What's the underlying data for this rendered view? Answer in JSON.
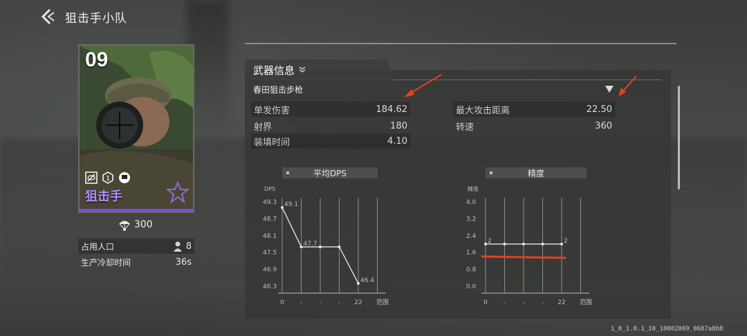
{
  "header": {
    "title": "狙击手小队"
  },
  "unit": {
    "number": "09",
    "role": "狙击手",
    "cost": "300",
    "stats": [
      {
        "label": "占用人口",
        "value": "8"
      },
      {
        "label": "生产冷却时间",
        "value": "36s"
      }
    ]
  },
  "weapon": {
    "tab_title": "武器信息",
    "name": "春田狙击步枪",
    "stats_left": [
      {
        "label": "单发伤害",
        "value": "184.62"
      },
      {
        "label": "射界",
        "value": "180"
      },
      {
        "label": "装填时间",
        "value": "4.10"
      }
    ],
    "stats_right": [
      {
        "label": "最大攻击距离",
        "value": "22.50"
      },
      {
        "label": "转速",
        "value": "360"
      }
    ]
  },
  "chart_data": [
    {
      "type": "line",
      "title": "平均DPS",
      "ylabel": "DPS",
      "xlabel": "范围",
      "x_ticks": [
        "0",
        "-",
        "-",
        "-",
        "22"
      ],
      "y_ticks": [
        "49.3",
        "48.7",
        "48.1",
        "47.5",
        "46.9",
        "46.3"
      ],
      "ylim": [
        46.3,
        49.3
      ],
      "series": [
        {
          "values": [
            49.1,
            47.7,
            47.7,
            47.7,
            46.4
          ],
          "labels": [
            "49.1",
            "47.7",
            "",
            "",
            "46.4"
          ]
        }
      ]
    },
    {
      "type": "line",
      "title": "精度",
      "ylabel": "精准",
      "xlabel": "范围",
      "x_ticks": [
        "0",
        "-",
        "-",
        "-",
        "22"
      ],
      "y_ticks": [
        "4.0",
        "3.2",
        "2.4",
        "1.6",
        "0.8",
        "0.0"
      ],
      "ylim": [
        0,
        4.0
      ],
      "series": [
        {
          "values": [
            2,
            2,
            2,
            2,
            2
          ],
          "labels": [
            "2",
            "",
            "",
            "",
            "2"
          ]
        }
      ]
    }
  ],
  "footer": {
    "build": "1_0_1.0.1_10_10002069_0687a8b8"
  },
  "colors": {
    "accent": "#b48cff",
    "annotation": "#e8401c"
  }
}
